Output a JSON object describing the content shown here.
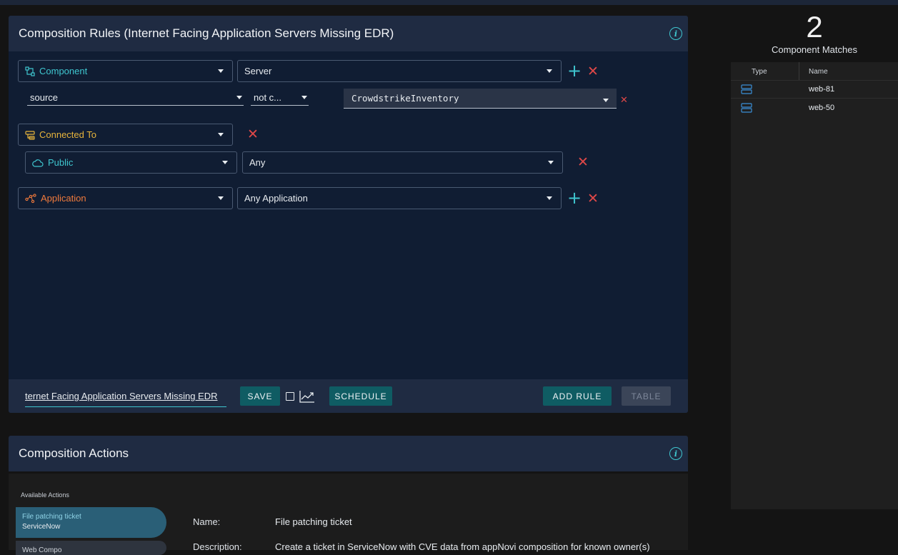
{
  "rules": {
    "title": "Composition Rules (Internet Facing Application Servers Missing EDR)",
    "component_label": "Component",
    "component_value": "Server",
    "filter_field": "source",
    "filter_op": "not c...",
    "filter_value": "CrowdstrikeInventory",
    "connected_label": "Connected To",
    "public_label": "Public",
    "public_value": "Any",
    "application_label": "Application",
    "application_value": "Any Application",
    "name_input_value": "ternet Facing Application Servers Missing EDR",
    "save_label": "SAVE",
    "schedule_label": "SCHEDULE",
    "add_rule_label": "ADD RULE",
    "table_label": "TABLE"
  },
  "actions": {
    "title": "Composition Actions",
    "available_label": "Available Actions",
    "items": [
      {
        "title": "File patching ticket",
        "subtitle": "ServiceNow"
      },
      {
        "title": "Web Compo",
        "subtitle": ""
      }
    ],
    "detail_name_label": "Name:",
    "detail_name_value": "File patching ticket",
    "detail_desc_label": "Description:",
    "detail_desc_value": "Create a ticket in ServiceNow with CVE data from appNovi composition for known owner(s)"
  },
  "matches": {
    "count": "2",
    "label": "Component Matches",
    "col_type": "Type",
    "col_name": "Name",
    "rows": [
      {
        "type_icon": "server-icon",
        "name": "web-81"
      },
      {
        "type_icon": "server-icon",
        "name": "web-50"
      }
    ]
  },
  "colors": {
    "accent_teal": "#3fc6cf",
    "component": "#3fc6cf",
    "connected": "#e6b43c",
    "public": "#3fc6cf",
    "application": "#f07a3c",
    "remove": "#e04848"
  }
}
